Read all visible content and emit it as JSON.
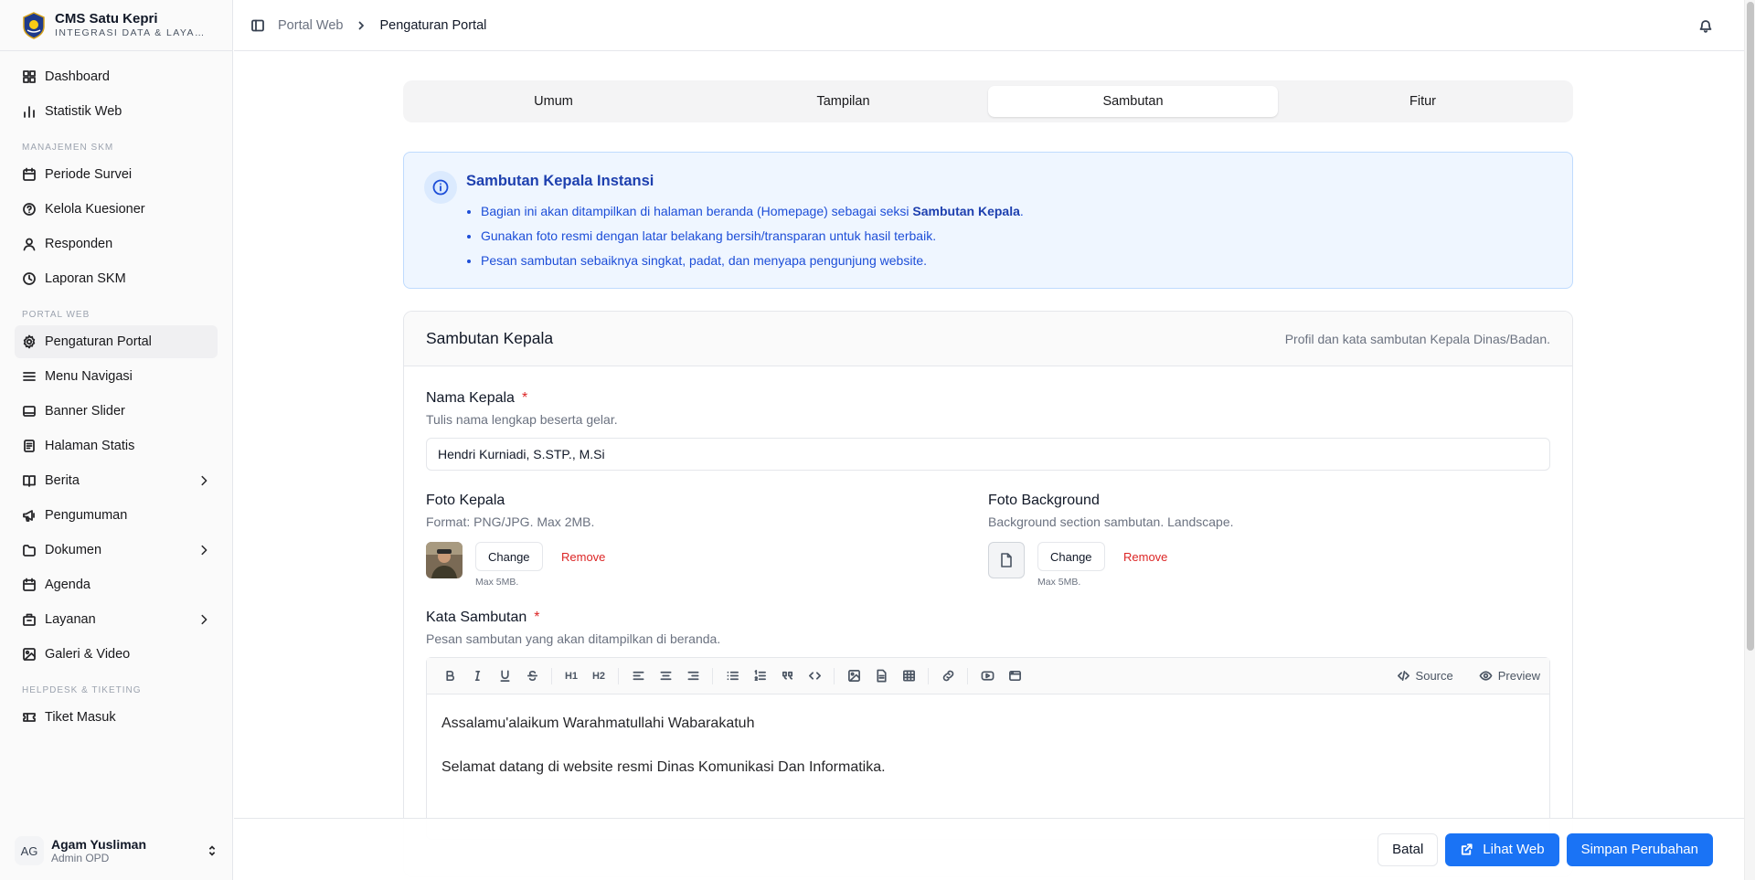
{
  "app": {
    "title": "CMS Satu Kepri",
    "subtitle": "INTEGRASI DATA & LAYANAN PUBLIK"
  },
  "sidebar": {
    "main": [
      {
        "label": "Dashboard",
        "icon": "dashboard-icon"
      },
      {
        "label": "Statistik Web",
        "icon": "chart-icon"
      }
    ],
    "groups": [
      {
        "title": "MANAJEMEN SKM",
        "items": [
          {
            "label": "Periode Survei",
            "icon": "calendar-icon"
          },
          {
            "label": "Kelola Kuesioner",
            "icon": "help-circle-icon"
          },
          {
            "label": "Responden",
            "icon": "user-icon"
          },
          {
            "label": "Laporan SKM",
            "icon": "clock-icon"
          }
        ]
      },
      {
        "title": "PORTAL WEB",
        "items": [
          {
            "label": "Pengaturan Portal",
            "icon": "gear-icon",
            "active": true
          },
          {
            "label": "Menu Navigasi",
            "icon": "menu-icon"
          },
          {
            "label": "Banner Slider",
            "icon": "banner-icon"
          },
          {
            "label": "Halaman Statis",
            "icon": "page-icon"
          },
          {
            "label": "Berita",
            "icon": "book-icon",
            "expandable": true
          },
          {
            "label": "Pengumuman",
            "icon": "megaphone-icon"
          },
          {
            "label": "Dokumen",
            "icon": "folder-icon",
            "expandable": true
          },
          {
            "label": "Agenda",
            "icon": "calendar-icon"
          },
          {
            "label": "Layanan",
            "icon": "building-icon",
            "expandable": true
          },
          {
            "label": "Galeri & Video",
            "icon": "image-icon"
          }
        ]
      },
      {
        "title": "HELPDESK & TIKETING",
        "items": [
          {
            "label": "Tiket Masuk",
            "icon": "ticket-icon"
          }
        ]
      }
    ]
  },
  "user": {
    "initials": "AG",
    "name": "Agam Yusliman",
    "role": "Admin OPD"
  },
  "header": {
    "breadcrumb_parent": "Portal Web",
    "breadcrumb_current": "Pengaturan Portal"
  },
  "tabs": [
    {
      "label": "Umum",
      "active": false
    },
    {
      "label": "Tampilan",
      "active": false
    },
    {
      "label": "Sambutan",
      "active": true
    },
    {
      "label": "Fitur",
      "active": false
    }
  ],
  "info": {
    "title": "Sambutan Kepala Instansi",
    "bullet1_pre": "Bagian ini akan ditampilkan di halaman beranda (Homepage) sebagai seksi ",
    "bullet1_bold": "Sambutan Kepala",
    "bullet1_post": ".",
    "bullet2": "Gunakan foto resmi dengan latar belakang bersih/transparan untuk hasil terbaik.",
    "bullet3": "Pesan sambutan sebaiknya singkat, padat, dan menyapa pengunjung website."
  },
  "card": {
    "title": "Sambutan Kepala",
    "description": "Profil dan kata sambutan Kepala Dinas/Badan.",
    "nama": {
      "label": "Nama Kepala",
      "required": "*",
      "help": "Tulis nama lengkap beserta gelar.",
      "value": "Hendri Kurniadi, S.STP., M.Si"
    },
    "foto_kepala": {
      "label": "Foto Kepala",
      "help": "Format: PNG/JPG. Max 2MB.",
      "change": "Change",
      "remove": "Remove",
      "note": "Max 5MB."
    },
    "foto_background": {
      "label": "Foto Background",
      "help": "Background section sambutan. Landscape.",
      "change": "Change",
      "remove": "Remove",
      "note": "Max 5MB."
    },
    "kata": {
      "label": "Kata Sambutan",
      "required": "*",
      "help": "Pesan sambutan yang akan ditampilkan di beranda.",
      "source_label": "Source",
      "preview_label": "Preview",
      "toolbar_h1": "H1",
      "toolbar_h2": "H2",
      "paragraphs": [
        "Assalamu'alaikum Warahmatullahi Wabarakatuh",
        "Selamat datang di website resmi Dinas Komunikasi Dan Informatika."
      ]
    }
  },
  "actions": {
    "cancel": "Batal",
    "view_web": "Lihat Web",
    "save": "Simpan Perubahan"
  },
  "colors": {
    "primary": "#1a73f5",
    "info_bg": "#eff6ff",
    "info_text": "#1d4ed8",
    "danger": "#dc2626"
  }
}
